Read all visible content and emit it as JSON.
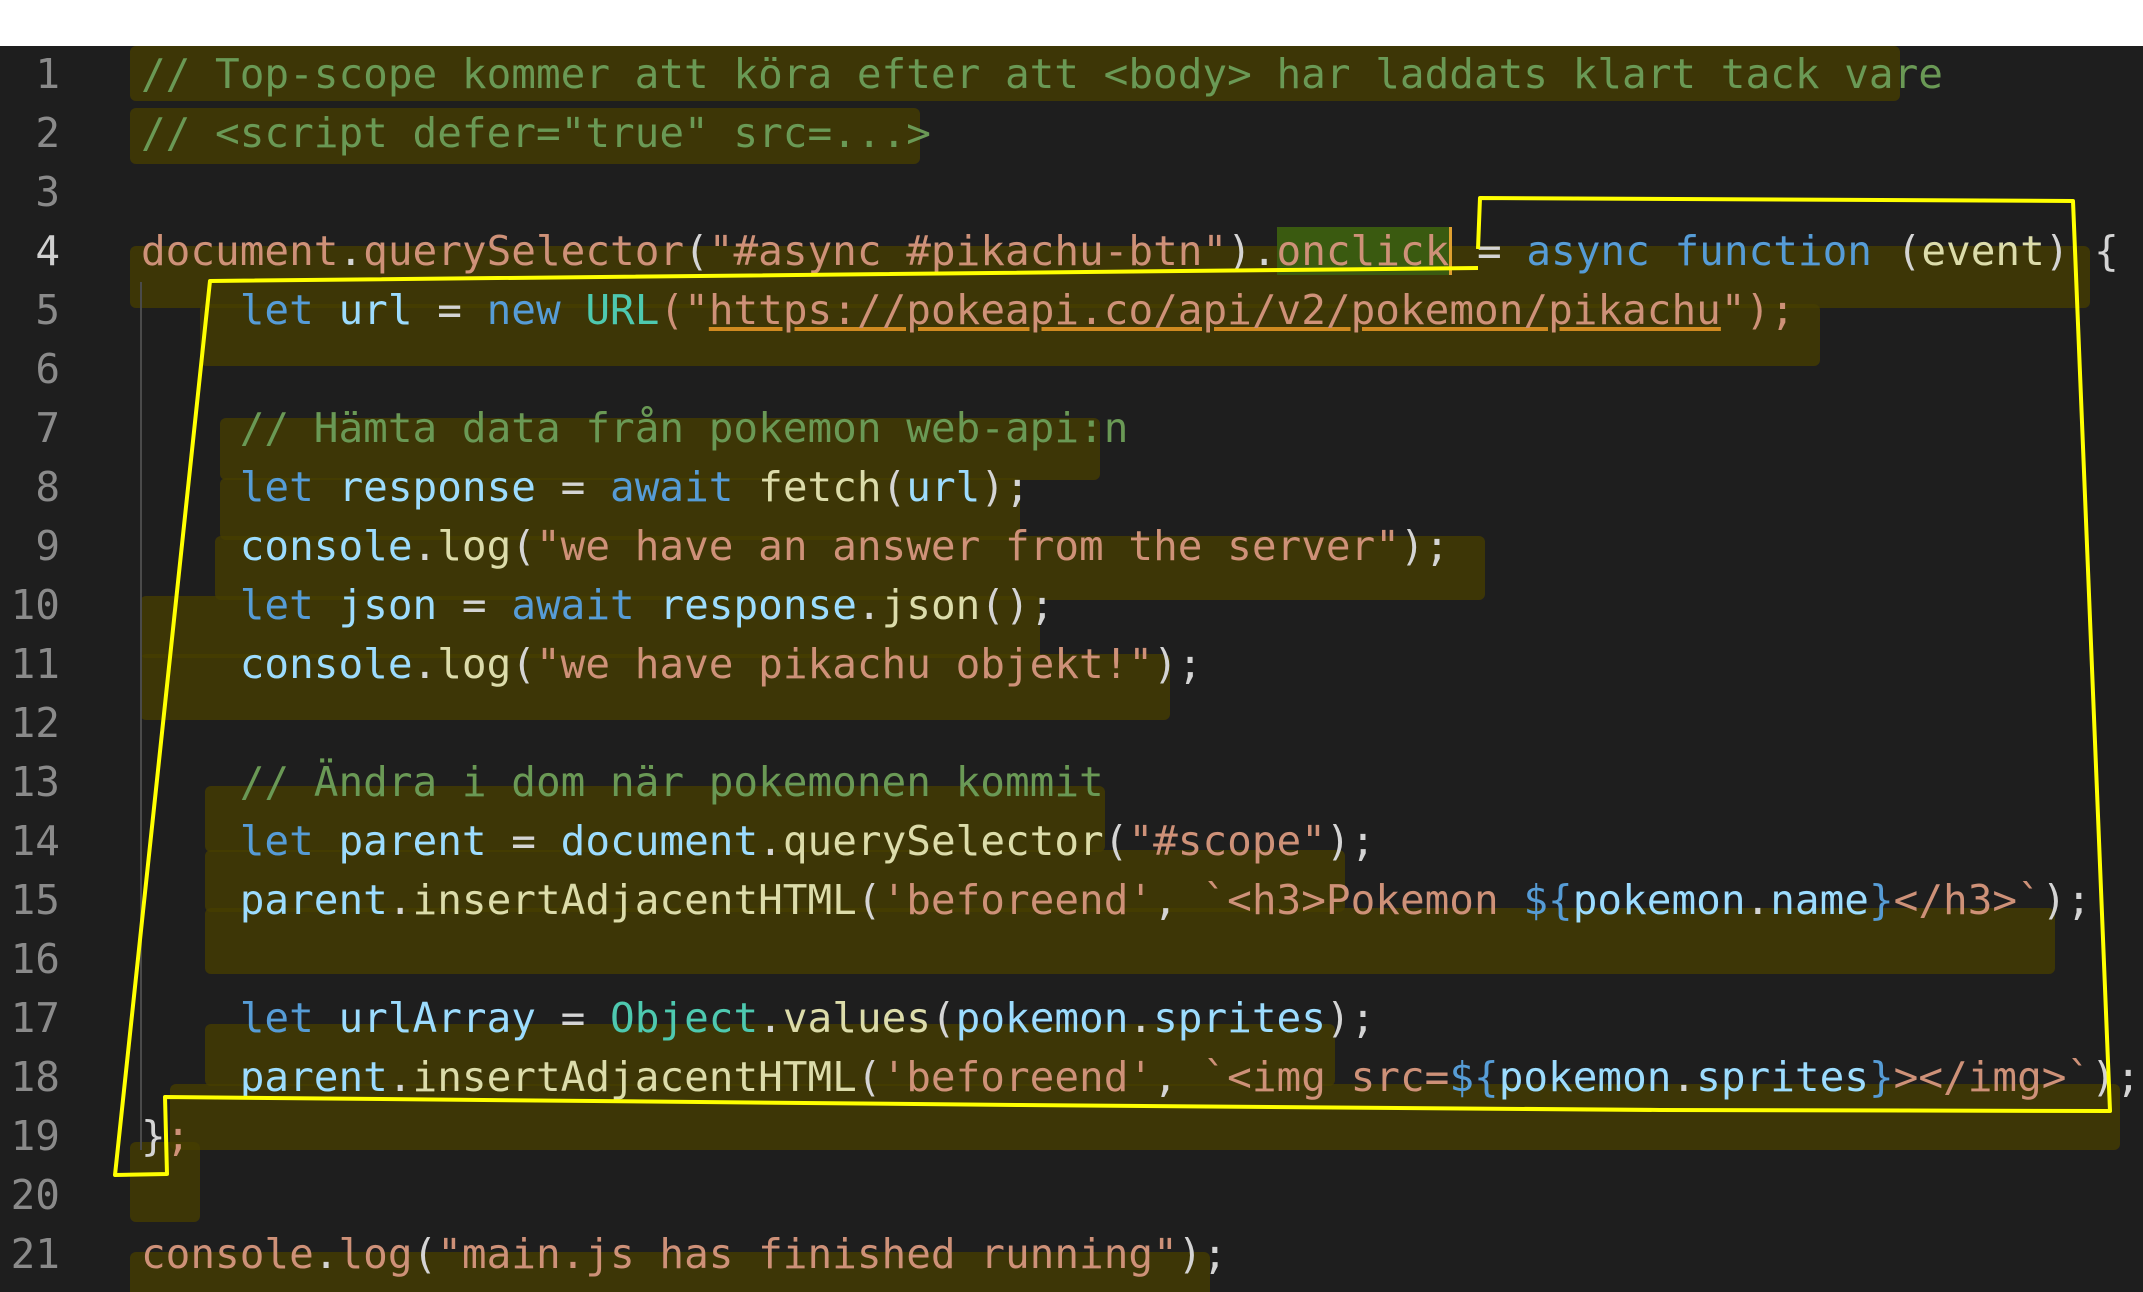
{
  "editor": {
    "theme_colors": {
      "background": "#1e1e1e",
      "highlight_overlay": "#463e00",
      "annotation_stroke": "#ffff00"
    },
    "active_line": 4,
    "lines": [
      {
        "number": "1",
        "tokens": [
          {
            "t": "// Top-scope kommer att köra efter att <body> har laddats klart tack vare",
            "c": "c-comment"
          }
        ]
      },
      {
        "number": "2",
        "tokens": [
          {
            "t": "// <script defer=\"true\" src=...>",
            "c": "c-comment"
          }
        ]
      },
      {
        "number": "3",
        "tokens": []
      },
      {
        "number": "4",
        "tokens": [
          {
            "t": "document",
            "c": "c-str"
          },
          {
            "t": ".",
            "c": "c-punc"
          },
          {
            "t": "querySelector",
            "c": "c-str"
          },
          {
            "t": "(",
            "c": "c-punc"
          },
          {
            "t": "\"#async #pikachu-btn\"",
            "c": "c-str"
          },
          {
            "t": ").",
            "c": "c-punc"
          },
          {
            "t": "onclick",
            "c": "c-str c-prop-hl c-caret"
          },
          {
            "t": " = ",
            "c": "c-punc"
          },
          {
            "t": "async function ",
            "c": "c-kw"
          },
          {
            "t": "(",
            "c": "c-punc"
          },
          {
            "t": "event",
            "c": "c-ident"
          },
          {
            "t": ") {",
            "c": "c-punc"
          }
        ]
      },
      {
        "number": "5",
        "tokens": [
          {
            "t": "    ",
            "c": "c-punc"
          },
          {
            "t": "let ",
            "c": "c-kw"
          },
          {
            "t": "url",
            "c": "c-var"
          },
          {
            "t": " = ",
            "c": "c-punc"
          },
          {
            "t": "new ",
            "c": "c-kw"
          },
          {
            "t": "URL",
            "c": "c-cls"
          },
          {
            "t": "(\"",
            "c": "c-str"
          },
          {
            "t": "https://pokeapi.co/api/v2/pokemon/pikachu",
            "c": "c-link"
          },
          {
            "t": "\");",
            "c": "c-str"
          }
        ]
      },
      {
        "number": "6",
        "tokens": []
      },
      {
        "number": "7",
        "tokens": [
          {
            "t": "    ",
            "c": "c-punc"
          },
          {
            "t": "// Hämta data från pokemon web-api:n",
            "c": "c-comment"
          }
        ]
      },
      {
        "number": "8",
        "tokens": [
          {
            "t": "    ",
            "c": "c-punc"
          },
          {
            "t": "let ",
            "c": "c-kw"
          },
          {
            "t": "response",
            "c": "c-var"
          },
          {
            "t": " = ",
            "c": "c-punc"
          },
          {
            "t": "await ",
            "c": "c-kw"
          },
          {
            "t": "fetch",
            "c": "c-fn"
          },
          {
            "t": "(",
            "c": "c-punc"
          },
          {
            "t": "url",
            "c": "c-var"
          },
          {
            "t": ");",
            "c": "c-punc"
          }
        ]
      },
      {
        "number": "9",
        "tokens": [
          {
            "t": "    ",
            "c": "c-punc"
          },
          {
            "t": "console",
            "c": "c-var"
          },
          {
            "t": ".",
            "c": "c-punc"
          },
          {
            "t": "log",
            "c": "c-fn"
          },
          {
            "t": "(",
            "c": "c-punc"
          },
          {
            "t": "\"we have an answer from the server\"",
            "c": "c-str"
          },
          {
            "t": ");",
            "c": "c-punc"
          }
        ]
      },
      {
        "number": "10",
        "tokens": [
          {
            "t": "    ",
            "c": "c-punc"
          },
          {
            "t": "let ",
            "c": "c-kw"
          },
          {
            "t": "json",
            "c": "c-var"
          },
          {
            "t": " = ",
            "c": "c-punc"
          },
          {
            "t": "await ",
            "c": "c-kw"
          },
          {
            "t": "response",
            "c": "c-var"
          },
          {
            "t": ".",
            "c": "c-punc"
          },
          {
            "t": "json",
            "c": "c-fn"
          },
          {
            "t": "();",
            "c": "c-punc"
          }
        ]
      },
      {
        "number": "11",
        "tokens": [
          {
            "t": "    ",
            "c": "c-punc"
          },
          {
            "t": "console",
            "c": "c-var"
          },
          {
            "t": ".",
            "c": "c-punc"
          },
          {
            "t": "log",
            "c": "c-fn"
          },
          {
            "t": "(",
            "c": "c-punc"
          },
          {
            "t": "\"we have pikachu objekt!\"",
            "c": "c-str"
          },
          {
            "t": ");",
            "c": "c-punc"
          }
        ]
      },
      {
        "number": "12",
        "tokens": []
      },
      {
        "number": "13",
        "tokens": [
          {
            "t": "    ",
            "c": "c-punc"
          },
          {
            "t": "// Ändra i dom när pokemonen kommit",
            "c": "c-comment"
          }
        ]
      },
      {
        "number": "14",
        "tokens": [
          {
            "t": "    ",
            "c": "c-punc"
          },
          {
            "t": "let ",
            "c": "c-kw"
          },
          {
            "t": "parent",
            "c": "c-var"
          },
          {
            "t": " = ",
            "c": "c-punc"
          },
          {
            "t": "document",
            "c": "c-var"
          },
          {
            "t": ".",
            "c": "c-punc"
          },
          {
            "t": "querySelector",
            "c": "c-fn"
          },
          {
            "t": "(",
            "c": "c-punc"
          },
          {
            "t": "\"#scope\"",
            "c": "c-str"
          },
          {
            "t": ");",
            "c": "c-punc"
          }
        ]
      },
      {
        "number": "15",
        "tokens": [
          {
            "t": "    ",
            "c": "c-punc"
          },
          {
            "t": "parent",
            "c": "c-var"
          },
          {
            "t": ".",
            "c": "c-punc"
          },
          {
            "t": "insertAdjacentHTML",
            "c": "c-fn"
          },
          {
            "t": "(",
            "c": "c-punc"
          },
          {
            "t": "'beforeend'",
            "c": "c-str"
          },
          {
            "t": ", ",
            "c": "c-punc"
          },
          {
            "t": "`<h3>Pokemon ",
            "c": "c-str"
          },
          {
            "t": "${",
            "c": "c-kw"
          },
          {
            "t": "pokemon",
            "c": "c-var"
          },
          {
            "t": ".",
            "c": "c-punc"
          },
          {
            "t": "name",
            "c": "c-var"
          },
          {
            "t": "}",
            "c": "c-kw"
          },
          {
            "t": "</h3>`",
            "c": "c-str"
          },
          {
            "t": ");",
            "c": "c-punc"
          }
        ]
      },
      {
        "number": "16",
        "tokens": []
      },
      {
        "number": "17",
        "tokens": [
          {
            "t": "    ",
            "c": "c-punc"
          },
          {
            "t": "let ",
            "c": "c-kw"
          },
          {
            "t": "urlArray",
            "c": "c-var"
          },
          {
            "t": " = ",
            "c": "c-punc"
          },
          {
            "t": "Object",
            "c": "c-cls"
          },
          {
            "t": ".",
            "c": "c-punc"
          },
          {
            "t": "values",
            "c": "c-fn"
          },
          {
            "t": "(",
            "c": "c-punc"
          },
          {
            "t": "pokemon",
            "c": "c-var"
          },
          {
            "t": ".",
            "c": "c-punc"
          },
          {
            "t": "sprites",
            "c": "c-var"
          },
          {
            "t": ");",
            "c": "c-punc"
          }
        ]
      },
      {
        "number": "18",
        "tokens": [
          {
            "t": "    ",
            "c": "c-punc"
          },
          {
            "t": "parent",
            "c": "c-var"
          },
          {
            "t": ".",
            "c": "c-punc"
          },
          {
            "t": "insertAdjacentHTML",
            "c": "c-fn"
          },
          {
            "t": "(",
            "c": "c-punc"
          },
          {
            "t": "'beforeend'",
            "c": "c-str"
          },
          {
            "t": ", ",
            "c": "c-punc"
          },
          {
            "t": "`<img src=",
            "c": "c-str"
          },
          {
            "t": "${",
            "c": "c-kw"
          },
          {
            "t": "pokemon",
            "c": "c-var"
          },
          {
            "t": ".",
            "c": "c-punc"
          },
          {
            "t": "sprites",
            "c": "c-var"
          },
          {
            "t": "}",
            "c": "c-kw"
          },
          {
            "t": "></img>`",
            "c": "c-str"
          },
          {
            "t": ");",
            "c": "c-punc"
          }
        ]
      },
      {
        "number": "19",
        "tokens": [
          {
            "t": "}",
            "c": "c-punc"
          },
          {
            "t": ";",
            "c": "c-str"
          }
        ]
      },
      {
        "number": "20",
        "tokens": []
      },
      {
        "number": "21",
        "tokens": [
          {
            "t": "console",
            "c": "c-str"
          },
          {
            "t": ".",
            "c": "c-punc"
          },
          {
            "t": "log",
            "c": "c-str"
          },
          {
            "t": "(",
            "c": "c-punc"
          },
          {
            "t": "\"main.js has finished running\"",
            "c": "c-str"
          },
          {
            "t": ");",
            "c": "c-punc"
          }
        ]
      }
    ]
  }
}
